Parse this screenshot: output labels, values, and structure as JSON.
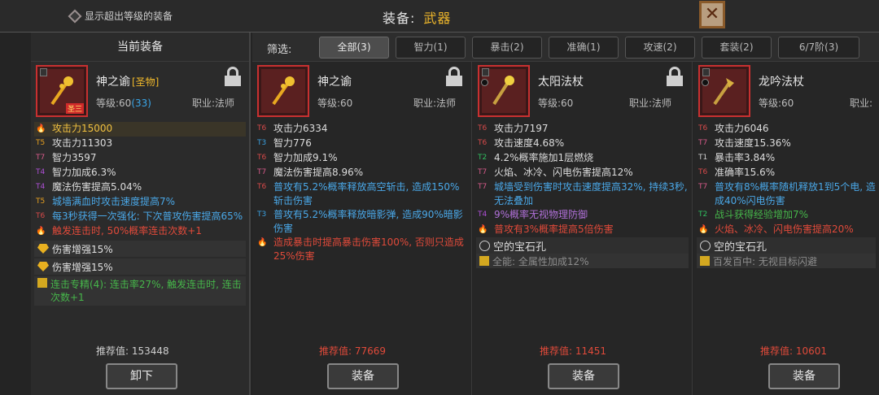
{
  "header": {
    "toggle_label": "显示超出等级的装备",
    "title_label": "装备:",
    "title_value": "武器",
    "close_icon": "close-x"
  },
  "left": {
    "heading": "当前装备",
    "name": "神之谕",
    "rarity": "[圣物]",
    "tag": "圣三",
    "level_prefix": "等级:60",
    "level_bonus": "(33)",
    "job": "职业:法师",
    "stats": [
      {
        "tier": "",
        "text": "攻击力15000",
        "color": "yel",
        "highlight": true
      },
      {
        "tier": "T5",
        "text": "攻击力11303",
        "color": ""
      },
      {
        "tier": "T7",
        "text": "智力3597",
        "color": ""
      },
      {
        "tier": "T4",
        "text": "智力加成6.3%",
        "color": ""
      },
      {
        "tier": "T4",
        "text": "魔法伤害提高5.04%",
        "color": ""
      },
      {
        "tier": "T5",
        "text": "城墙满血时攻击速度提高7%",
        "color": "blue"
      },
      {
        "tier": "T6",
        "text": "每3秒获得一次强化: 下次普攻伤害提高65%",
        "color": "blue"
      },
      {
        "tier": "",
        "text": "触发连击时, 50%概率连击次数+1",
        "color": "red"
      }
    ],
    "gems": [
      "伤害增强15%",
      "伤害增强15%"
    ],
    "set_text": "连击专精(4): 连击率27%, 触发连击时, 连击次数+1",
    "rec_label": "推荐值: 153448",
    "button": "卸下"
  },
  "filter": {
    "label": "筛选:",
    "tabs": [
      "全部(3)",
      "智力(1)",
      "暴击(2)",
      "准确(1)",
      "攻速(2)",
      "套装(2)",
      "6/7阶(3)"
    ]
  },
  "items": [
    {
      "name": "神之谕",
      "level": "等级:60",
      "job": "职业:法师",
      "stats": [
        {
          "tier": "T6",
          "text": "攻击力6334",
          "color": ""
        },
        {
          "tier": "T3",
          "text": "智力776",
          "color": ""
        },
        {
          "tier": "T6",
          "text": "智力加成9.1%",
          "color": ""
        },
        {
          "tier": "T7",
          "text": "魔法伤害提高8.96%",
          "color": ""
        },
        {
          "tier": "T6",
          "text": "普攻有5.2%概率释放高空斩击, 造成150%斩击伤害",
          "color": "blue"
        },
        {
          "tier": "T3",
          "text": "普攻有5.2%概率释放暗影弹, 造成90%暗影伤害",
          "color": "blue"
        },
        {
          "tier": "",
          "text": "造成暴击时提高暴击伤害100%, 否则只造成25%伤害",
          "color": "red"
        }
      ],
      "socket": "",
      "socket_gem": "",
      "rec": "推荐值: 77669",
      "button": "装备"
    },
    {
      "name": "太阳法杖",
      "level": "等级:60",
      "job": "职业:法师",
      "stats": [
        {
          "tier": "T6",
          "text": "攻击力7197",
          "color": ""
        },
        {
          "tier": "T6",
          "text": "攻击速度4.68%",
          "color": ""
        },
        {
          "tier": "T2",
          "text": "4.2%概率施加1层燃烧",
          "color": ""
        },
        {
          "tier": "T7",
          "text": "火焰、冰冷、闪电伤害提高12%",
          "color": ""
        },
        {
          "tier": "T7",
          "text": "城墙受到伤害时攻击速度提高32%, 持续3秒, 无法叠加",
          "color": "blue"
        },
        {
          "tier": "T4",
          "text": "9%概率无视物理防御",
          "color": "purple"
        },
        {
          "tier": "",
          "text": "普攻有3%概率提高5倍伤害",
          "color": "red"
        }
      ],
      "socket": "空的宝石孔",
      "socket_gem": "全能: 全属性加成12%",
      "rec": "推荐值: 11451",
      "button": "装备"
    },
    {
      "name": "龙吟法杖",
      "level": "等级:60",
      "job": "职业:",
      "stats": [
        {
          "tier": "T6",
          "text": "攻击力6046",
          "color": ""
        },
        {
          "tier": "T7",
          "text": "攻击速度15.36%",
          "color": ""
        },
        {
          "tier": "T1",
          "text": "暴击率3.84%",
          "color": ""
        },
        {
          "tier": "T6",
          "text": "准确率15.6%",
          "color": ""
        },
        {
          "tier": "T7",
          "text": "普攻有8%概率随机释放1到5个电, 造成40%闪电伤害",
          "color": "blue"
        },
        {
          "tier": "T2",
          "text": "战斗获得经验增加7%",
          "color": "green"
        },
        {
          "tier": "",
          "text": "火焰、冰冷、闪电伤害提高20%",
          "color": "red"
        }
      ],
      "socket": "空的宝石孔",
      "socket_gem": "百发百中: 无视目标闪避",
      "rec": "推荐值: 10601",
      "button": "装备"
    }
  ]
}
